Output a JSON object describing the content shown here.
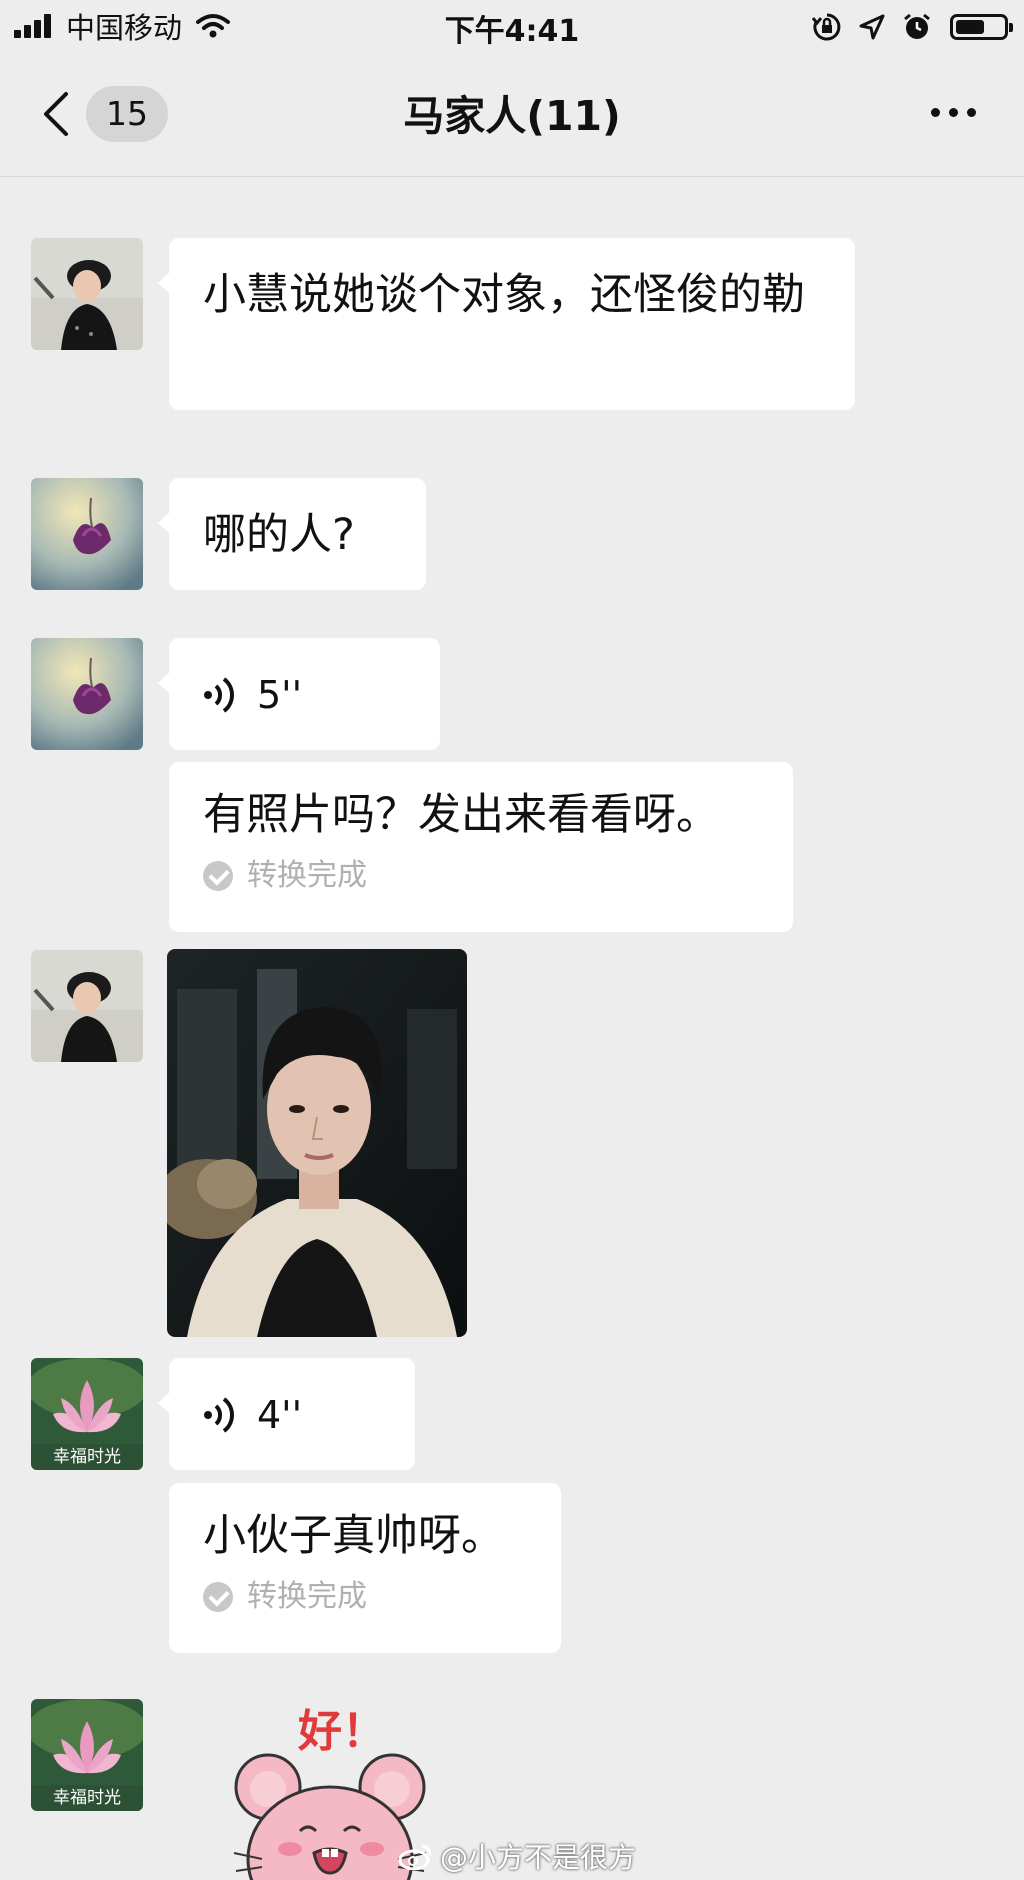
{
  "status_bar": {
    "carrier": "中国移动",
    "time": "下午4:41",
    "battery_level": 0.6,
    "icons": [
      "signal-icon",
      "wifi-icon",
      "orientation-lock-icon",
      "location-icon",
      "alarm-icon",
      "battery-icon"
    ]
  },
  "nav": {
    "back_icon": "chevron-left-icon",
    "unread_count": "15",
    "title": "马家人(11)",
    "more_icon": "more-dots-icon"
  },
  "messages": [
    {
      "sender_avatar": "avatar-man-photo",
      "type": "text",
      "text": "小慧说她谈个对象，还怪俊的勒"
    },
    {
      "sender_avatar": "avatar-purple-flower",
      "type": "text",
      "text": "哪的人?"
    },
    {
      "sender_avatar": "avatar-purple-flower",
      "type": "voice",
      "duration": "5''",
      "transcript": "有照片吗？发出来看看呀。",
      "transcript_status": "转换完成"
    },
    {
      "sender_avatar": "avatar-man-photo",
      "type": "image",
      "image": "portrait-photo"
    },
    {
      "sender_avatar": "avatar-lotus",
      "avatar_caption": "幸福时光",
      "type": "voice",
      "duration": "4''",
      "transcript": "小伙子真帅呀。",
      "transcript_status": "转换完成"
    },
    {
      "sender_avatar": "avatar-lotus",
      "avatar_caption": "幸福时光",
      "type": "sticker",
      "sticker_text": "好！",
      "sticker": "pink-mouse-sticker"
    }
  ],
  "watermark": "@小方不是很方",
  "colors": {
    "background": "#ededed",
    "bubble": "#ffffff",
    "sticker_text": "#e03a3a",
    "sticker_pink": "#f4b9c5"
  }
}
